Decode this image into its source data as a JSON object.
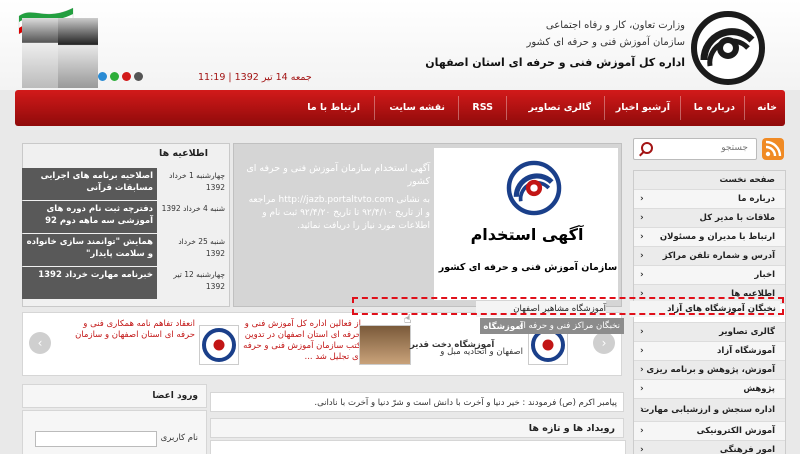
{
  "header": {
    "org_line1": "وزارت تعاون، کار و رفاه اجتماعی",
    "org_line2": "سازمان آموزش فنی و حرفه ای کشور",
    "org_line3": "اداره کل آموزش فنی و حرفه ای استان اصفهان",
    "time": "11:19",
    "date": "جمعه 14 تیر 1392",
    "theme_colors": [
      "#2a8bd4",
      "#2eae3a",
      "#d21a1a",
      "#555555"
    ],
    "brand_color": "#a31414"
  },
  "nav": {
    "items": [
      {
        "label": "خانه"
      },
      {
        "label": "درباره ما"
      },
      {
        "label": "آرشیو اخبار"
      },
      {
        "label": "گالری تصاویر"
      },
      {
        "label": "RSS"
      },
      {
        "label": "نقشه سایت"
      },
      {
        "label": "ارتباط با ما"
      }
    ]
  },
  "search": {
    "placeholder": "جستجو"
  },
  "sidebar": {
    "items": [
      {
        "label": "صفحه نخست"
      },
      {
        "label": "درباره ما"
      },
      {
        "label": "ملاقات با مدیر کل"
      },
      {
        "label": "ارتباط با مدیران و مسئولان"
      },
      {
        "label": "آدرس و شماره تلفن مراکز"
      },
      {
        "label": "اخبار"
      },
      {
        "label": "اطلاعیه ها"
      },
      {
        "label": "بانک اطلاعاتی نخبگان"
      },
      {
        "label": "گالری تصاویر"
      },
      {
        "label": "آموزشگاه آزاد"
      },
      {
        "label": "آموزش، پژوهش و برنامه ریزی"
      },
      {
        "label": "پژوهش"
      },
      {
        "label": "اداره سنجش و ارزشیابی مهارت"
      },
      {
        "label": "آموزش الکترونیکی"
      },
      {
        "label": "امور فرهنگی"
      }
    ]
  },
  "announcements": {
    "title": "اطلاعیه ها",
    "items": [
      {
        "text": "اصلاحیه برنامه های اجرایی مسابقات قرآنی",
        "date": "چهارشنبه 1 خرداد 1392"
      },
      {
        "text": "دفترچه ثبت نام دوره های آموزشی سه ماهه دوم 92",
        "date": "شنبه 4 خرداد 1392"
      },
      {
        "text": "همایش \"توانمند سازی خانواده و سلامت پایدار\"",
        "date": "شنبه 25 خرداد 1392"
      },
      {
        "text": "خبرنامه مهارت خرداد 1392",
        "date": "چهارشنبه 12 تیر 1392"
      }
    ]
  },
  "slider": {
    "ad_title": "آگهی استخدام",
    "ad_subtitle": "سازمان آموزش فنی و حرفه ای کشور",
    "ad_heading": "آگهی استخدام سازمان آموزش فنی و حرفه ای کشور",
    "ad_body": "به نشانی http://jazb.portaltvto.com مراجعه و از تاریخ ۹۲/۴/۱۰ تا تاریخ ۹۲/۴/۲۰ ثبت نام و اطلاعات مورد نیاز را دریافت نمائید."
  },
  "dropdown": {
    "row1": [
      "نخبگان آموزشگاه های آزاد",
      "آموزشگاه مشاهیر اصفهان"
    ],
    "row2": [
      "نخبگان مراکز فنی و حرفه ای",
      "آموزشگاه صالحات",
      "آموزشگاه دخت قدیر"
    ]
  },
  "news": {
    "item1": "انعقاد تفاهم نامه همکاری فنی و حرفه ای استان اصفهان و سازمان",
    "item2": "از فعالین اداره کل آموزش فنی و حرفه ای استان اصفهان در تدوین کتب سازمان آموزش فنی و حرفه ای تجلیل شد ...",
    "item3": "اصفهان و اتحادیه مبل و"
  },
  "login": {
    "title": "ورود اعضا",
    "username_label": "نام کاربری :"
  },
  "hadith": "پیامبر اکرم (ص) فرمودند : خیر دنیا و آخرت با دانش است و شرّ دنیا و آخرت با نادانی.",
  "events": {
    "title": "رویداد ها و تازه ها"
  }
}
